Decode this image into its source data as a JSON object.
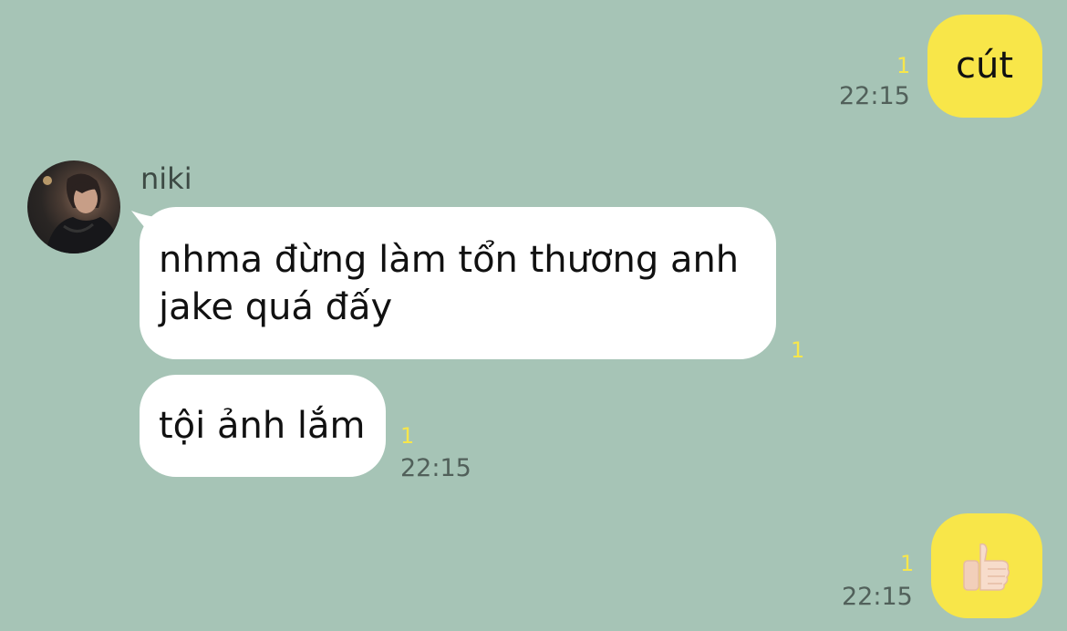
{
  "contact": {
    "name": "niki"
  },
  "messages": [
    {
      "id": "m1",
      "direction": "outgoing",
      "text": "cút",
      "unread_count": "1",
      "time": "22:15"
    },
    {
      "id": "m2",
      "direction": "incoming",
      "text": "nhma đừng làm tổn thương anh jake quá đấy",
      "unread_count": "1",
      "time": ""
    },
    {
      "id": "m3",
      "direction": "incoming",
      "text": "tội ảnh lắm",
      "unread_count": "1",
      "time": "22:15"
    },
    {
      "id": "m4",
      "direction": "outgoing",
      "text": "👍🏻",
      "unread_count": "1",
      "time": "22:15"
    }
  ],
  "colors": {
    "background": "#a6c4b6",
    "outgoing_bubble": "#f8e649",
    "incoming_bubble": "#ffffff",
    "unread_counter": "#f7e64b",
    "timestamp": "#51605a"
  },
  "icons": {
    "thumbs_up": "thumbs-up-emoji"
  }
}
